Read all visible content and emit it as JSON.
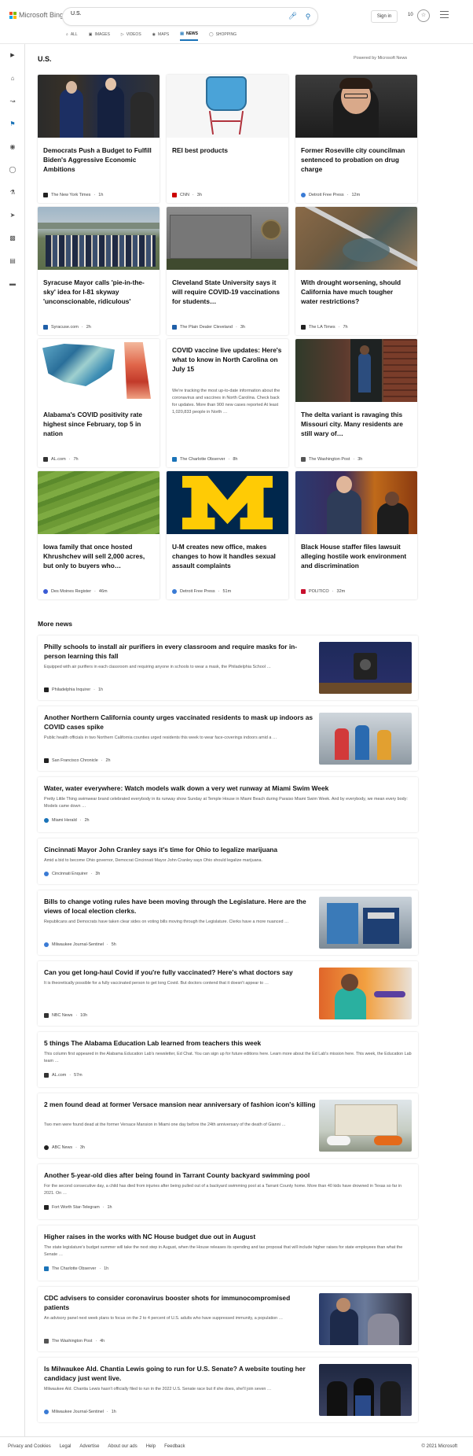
{
  "brand": {
    "name": "Microsoft Bing"
  },
  "search": {
    "query": "U.S."
  },
  "header": {
    "sign_in": "Sign in",
    "rewards_points": "10"
  },
  "scopes": [
    {
      "label": "ALL",
      "icon": "search-icon"
    },
    {
      "label": "IMAGES",
      "icon": "image-icon"
    },
    {
      "label": "VIDEOS",
      "icon": "video-icon"
    },
    {
      "label": "MAPS",
      "icon": "map-pin-icon"
    },
    {
      "label": "NEWS",
      "icon": "news-icon",
      "active": true
    },
    {
      "label": "SHOPPING",
      "icon": "tag-icon"
    }
  ],
  "section": {
    "title": "U.S.",
    "powered_by": "Powered by Microsoft News"
  },
  "cards": [
    {
      "title": "Democrats Push a Budget to Fulfill Biden's Aggressive Economic Ambitions",
      "source": "The New York Times",
      "time": "1h",
      "src_color": "#222"
    },
    {
      "title": "REI best products",
      "source": "CNN",
      "time": "3h",
      "src_color": "#cc0000"
    },
    {
      "title": "Former Roseville city councilman sentenced to probation on drug charge",
      "source": "Detroit Free Press",
      "time": "12m",
      "src_color": "#3a7bd5"
    },
    {
      "title": "Syracuse Mayor calls 'pie-in-the-sky' idea for I-81 skyway 'unconscionable, ridiculous'",
      "source": "Syracuse.com",
      "time": "2h",
      "src_color": "#1f5fa8"
    },
    {
      "title": "Cleveland State University says it will require COVID-19 vaccinations for students…",
      "source": "The Plain Dealer Cleveland",
      "time": "3h",
      "src_color": "#1f5fa8"
    },
    {
      "title": "With drought worsening, should California have much tougher water restrictions?",
      "source": "The LA Times",
      "time": "7h",
      "src_color": "#222"
    },
    {
      "title": "Alabama's COVID positivity rate highest since February, top 5 in nation",
      "source": "AL.com",
      "time": "7h",
      "src_color": "#333"
    },
    {
      "title": "COVID vaccine live updates: Here's what to know in North Carolina on July 15",
      "snippet": "We're tracking the most up-to-date information about the coronavirus and vaccines in North Carolina. Check back for updates. More than 900 new cases reported At least 1,020,833 people in North …",
      "source": "The Charlotte Observer",
      "time": "8h",
      "src_color": "#1a73b8"
    },
    {
      "title": "The delta variant is ravaging this Missouri city. Many residents are still wary of…",
      "source": "The Washington Post",
      "time": "3h",
      "src_color": "#555"
    },
    {
      "title": "Iowa family that once hosted Khrushchev will sell 2,000 acres, but only to buyers who…",
      "source": "Des Moines Register",
      "time": "46m",
      "src_color": "#3a5bd5"
    },
    {
      "title": "U-M creates new office, makes changes to how it handles sexual assault complaints",
      "source": "Detroit Free Press",
      "time": "51m",
      "src_color": "#3a7bd5"
    },
    {
      "title": "Black House staffer files lawsuit alleging hostile work environment and discrimination",
      "source": "POLITICO",
      "time": "32m",
      "src_color": "#c8102e"
    }
  ],
  "more_news": {
    "title": "More news"
  },
  "news": [
    {
      "title": "Philly schools to install air purifiers in every classroom and require masks for in-person learning this fall",
      "snippet": "Equipped with air purifiers in each classroom and requiring anyone in schools to wear a mask, the Philadelphia School …",
      "source": "Philadelphia Inquirer",
      "time": "1h",
      "src_color": "#222"
    },
    {
      "title": "Another Northern California county urges vaccinated residents to mask up indoors as COVID cases spike",
      "snippet": "Public health officials in two Northern California counties urged residents this week to wear face-coverings indoors amid a …",
      "source": "San Francisco Chronicle",
      "time": "2h",
      "src_color": "#222"
    },
    {
      "title": "Water, water everywhere: Watch models walk down a very wet runway at Miami Swim Week",
      "snippet": "Pretty Little Thing swimwear brand celebrated everybody in its runway show Sunday at Temple House in Miami Beach during Paraiso Miami Swim Week. And by everybody, we mean every body: Models came down …",
      "source": "Miami Herald",
      "time": "2h",
      "src_color": "#1a73b8"
    },
    {
      "title": "Cincinnati Mayor John Cranley says it's time for Ohio to legalize marijuana",
      "snippet": "Amid a bid to become Ohio governor, Democrat Cincinnati Mayor John Cranley says Ohio should legalize marijuana.",
      "source": "Cincinnati Enquirer",
      "time": "3h",
      "src_color": "#3a7bd5"
    },
    {
      "title": "Bills to change voting rules have been moving through the Legislature. Here are the views of local election clerks.",
      "snippet": "Republicans and Democrats have taken clear sides on voting bills moving through the Legislature. Clerks have a more nuanced …",
      "source": "Milwaukee Journal-Sentinel",
      "time": "5h",
      "src_color": "#3a7bd5"
    },
    {
      "title": "Can you get long-haul Covid if you're fully vaccinated? Here's what doctors say",
      "snippet": "It is theoretically possible for a fully vaccinated person to get long Covid. But doctors contend that it doesn't appear to …",
      "source": "NBC News",
      "time": "10h",
      "src_color": "#333"
    },
    {
      "title": "5 things The Alabama Education Lab learned from teachers this week",
      "snippet": "This column first appeared in the Alabama Education Lab's newsletter, Ed Chat. You can sign up for future editions here. Learn more about the Ed Lab's mission here. This week, the Education Lab team …",
      "source": "AL.com",
      "time": "57m",
      "src_color": "#333"
    },
    {
      "title": "2 men found dead at former Versace mansion near anniversary of fashion icon's killing",
      "snippet": "Two men were found dead at the former Versace Mansion in Miami one day before the 24th anniversary of the death of Gianni …",
      "source": "ABC News",
      "time": "3h",
      "src_color": "#222"
    },
    {
      "title": "Another 5-year-old dies after being found in Tarrant County backyard swimming pool",
      "snippet": "For the second consecutive day, a child has died from injuries after being pulled out of a backyard swimming pool at a Tarrant County home. More than 40 kids have drowned in Texas so far in 2021. On …",
      "source": "Fort Worth Star-Telegram",
      "time": "1h",
      "src_color": "#222"
    },
    {
      "title": "Higher raises in the works with NC House budget due out in August",
      "snippet": "The state legislature's budget summer will take the next step in August, when the House releases its spending and tax proposal that will include higher raises for state employees than what the Senate …",
      "source": "The Charlotte Observer",
      "time": "1h",
      "src_color": "#1a73b8"
    },
    {
      "title": "CDC advisers to consider coronavirus booster shots for immunocompromised patients",
      "snippet": "An advisory panel next week plans to focus on the 2 to 4 percent of U.S. adults who have suppressed immunity, a population …",
      "source": "The Washington Post",
      "time": "4h",
      "src_color": "#555"
    },
    {
      "title": "Is Milwaukee Ald. Chantia Lewis going to run for U.S. Senate? A website touting her candidacy just went live.",
      "snippet": "Milwaukee Ald. Chantia Lewis hasn't officially filed to run in the 2022 U.S. Senate race but if she does, she'll join seven …",
      "source": "Milwaukee Journal-Sentinel",
      "time": "1h",
      "src_color": "#3a7bd5"
    }
  ],
  "footer": {
    "links": [
      "Privacy and Cookies",
      "Legal",
      "Advertise",
      "About our ads",
      "Help",
      "Feedback"
    ],
    "copyright": "© 2021 Microsoft"
  }
}
